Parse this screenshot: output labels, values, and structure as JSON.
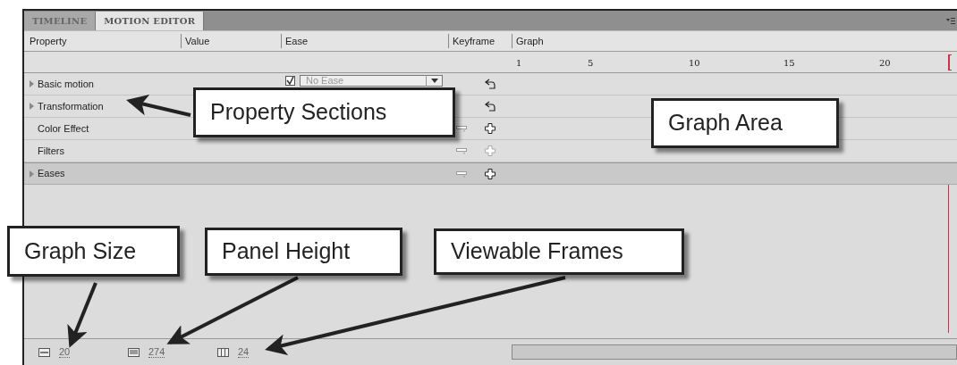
{
  "tabs": [
    {
      "label": "TIMELINE",
      "selected": false
    },
    {
      "label": "MOTION EDITOR",
      "selected": true
    }
  ],
  "columns": [
    "Property",
    "Value",
    "Ease",
    "Keyframe",
    "Graph"
  ],
  "ruler": [
    "1",
    "5",
    "10",
    "15",
    "20"
  ],
  "rows": [
    {
      "label": "Basic motion",
      "collapsible": true,
      "ease": {
        "checked": true,
        "value": "No Ease"
      },
      "kind": "reset",
      "disabled": false,
      "highlighted": false
    },
    {
      "label": "Transformation",
      "collapsible": true,
      "kind": "reset",
      "disabled": false,
      "highlighted": false
    },
    {
      "label": "Color Effect",
      "collapsible": false,
      "kind": "add",
      "disabled": false,
      "highlighted": false
    },
    {
      "label": "Filters",
      "collapsible": false,
      "kind": "add",
      "disabled": true,
      "highlighted": false
    },
    {
      "label": "Eases",
      "collapsible": true,
      "kind": "add",
      "disabled": false,
      "highlighted": true
    }
  ],
  "footer": [
    {
      "kind": "graph_size",
      "value": "20"
    },
    {
      "kind": "panel_height",
      "value": "274"
    },
    {
      "kind": "viewable_frames",
      "value": "24"
    }
  ],
  "annotations": [
    "Property Sections",
    "Graph Area",
    "Graph Size",
    "Panel Height",
    "Viewable Frames"
  ]
}
